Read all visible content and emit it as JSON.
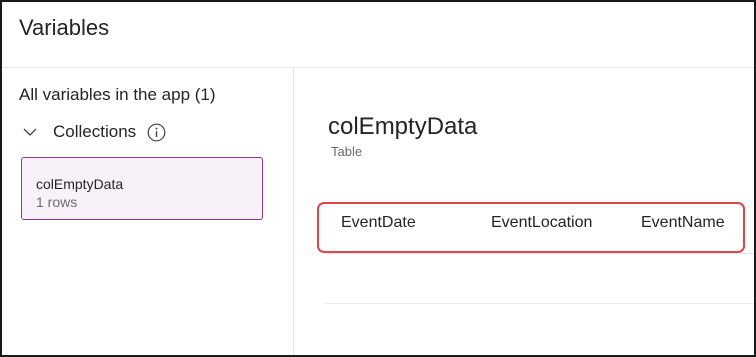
{
  "header": {
    "title": "Variables"
  },
  "sidebar": {
    "heading": "All variables in the app (1)",
    "tree": [
      {
        "label": "Collections",
        "expanded": true,
        "icon": "chevron-down-icon",
        "info_icon": "info-icon"
      }
    ],
    "items": [
      {
        "name": "colEmptyData",
        "rows": "1 rows",
        "selected": true
      }
    ]
  },
  "main": {
    "title": "colEmptyData",
    "type": "Table",
    "columns": [
      "EventDate",
      "EventLocation",
      "EventName"
    ]
  },
  "colors": {
    "selected_bg": "#f9f1fa",
    "selected_border": "#8a3a8a",
    "highlight_border": "#e04545",
    "divider": "#e6e6e6"
  }
}
